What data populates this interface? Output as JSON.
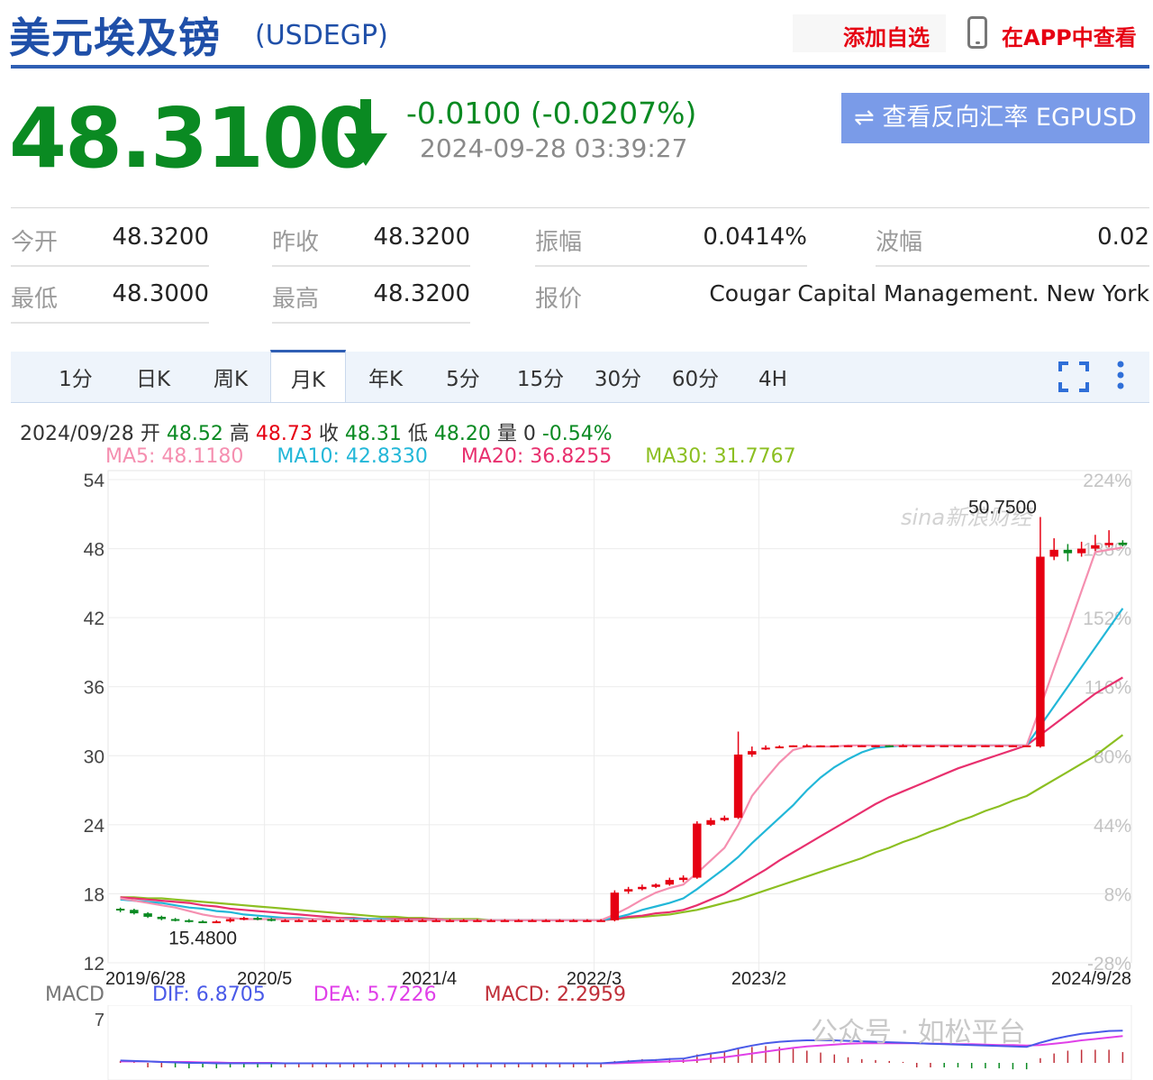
{
  "header": {
    "title": "美元埃及镑",
    "code": "(USDEGP)",
    "add_watchlist": "添加自选",
    "view_in_app": "在APP中查看"
  },
  "quote": {
    "price": "48.3100",
    "change": "-0.0100 (-0.0207%)",
    "timestamp": "2024-09-28 03:39:27",
    "reverse_button": "⇌ 查看反向汇率 EGPUSD"
  },
  "stats": {
    "open_label": "今开",
    "open": "48.3200",
    "prev_close_label": "昨收",
    "prev_close": "48.3200",
    "amplitude_label": "振幅",
    "amplitude": "0.0414%",
    "wave_label": "波幅",
    "wave": "0.02",
    "low_label": "最低",
    "low": "48.3000",
    "high_label": "最高",
    "high": "48.3200",
    "quoter_label": "报价",
    "quoter": "Cougar Capital Management. New York"
  },
  "tabs": [
    "1分",
    "日K",
    "周K",
    "月K",
    "年K",
    "5分",
    "15分",
    "30分",
    "60分",
    "4H"
  ],
  "active_tab": "月K",
  "ohlc": {
    "date": "2024/09/28",
    "open_label": "开",
    "open": "48.52",
    "high_label": "高",
    "high": "48.73",
    "close_label": "收",
    "close": "48.31",
    "low_label": "低",
    "low": "48.20",
    "vol_label": "量",
    "vol": "0",
    "pct": "-0.54%"
  },
  "ma": {
    "ma5": "MA5: 48.1180",
    "ma10": "MA10: 42.8330",
    "ma20": "MA20: 36.8255",
    "ma30": "MA30: 31.7767"
  },
  "macd": {
    "label": "MACD",
    "dif": "DIF: 6.8705",
    "dea": "DEA: 5.7226",
    "macd": "MACD: 2.2959",
    "y_tick": "7"
  },
  "watermark": {
    "brand": "sina新浪财经",
    "wechat": "公众号 · 如松平台"
  },
  "colors": {
    "up": "#e60012",
    "down": "#0a8a22",
    "ma5": "#f58fb0",
    "ma10": "#22b7d8",
    "ma20": "#e8306e",
    "ma30": "#8cbf22",
    "dif": "#4a5ae8",
    "dea": "#e040e8",
    "macd": "#c0303a"
  },
  "chart_data": {
    "type": "candlestick",
    "ylim": [
      12,
      54
    ],
    "y_ticks": [
      54,
      48,
      42,
      36,
      30,
      24,
      18,
      12
    ],
    "pct_ticks": [
      "224%",
      "188%",
      "152%",
      "116%",
      "80%",
      "44%",
      "8%",
      "-28%"
    ],
    "x_labels": [
      "2019/6/28",
      "2020/5",
      "2021/4",
      "2022/3",
      "2023/2",
      "2024/9/28"
    ],
    "annotations": {
      "max": "50.7500",
      "min": "15.4800"
    },
    "candles": [
      [
        16.7,
        16.6,
        16.8,
        16.4
      ],
      [
        16.6,
        16.3,
        16.7,
        16.2
      ],
      [
        16.3,
        16.0,
        16.4,
        15.9
      ],
      [
        16.0,
        15.8,
        16.1,
        15.7
      ],
      [
        15.8,
        15.7,
        15.9,
        15.6
      ],
      [
        15.7,
        15.6,
        15.8,
        15.5
      ],
      [
        15.6,
        15.5,
        15.7,
        15.48
      ],
      [
        15.5,
        15.6,
        15.7,
        15.48
      ],
      [
        15.6,
        15.8,
        15.9,
        15.5
      ],
      [
        15.8,
        15.9,
        16.0,
        15.7
      ],
      [
        15.9,
        15.8,
        16.0,
        15.7
      ],
      [
        15.8,
        15.7,
        15.9,
        15.6
      ],
      [
        15.7,
        15.7,
        15.8,
        15.6
      ],
      [
        15.7,
        15.7,
        15.8,
        15.6
      ],
      [
        15.7,
        15.7,
        15.8,
        15.6
      ],
      [
        15.7,
        15.7,
        15.8,
        15.6
      ],
      [
        15.7,
        15.7,
        15.8,
        15.6
      ],
      [
        15.7,
        15.7,
        15.8,
        15.6
      ],
      [
        15.7,
        15.7,
        15.8,
        15.6
      ],
      [
        15.7,
        15.7,
        15.8,
        15.6
      ],
      [
        15.7,
        15.7,
        15.8,
        15.6
      ],
      [
        15.7,
        15.7,
        15.8,
        15.6
      ],
      [
        15.7,
        15.7,
        15.8,
        15.6
      ],
      [
        15.7,
        15.7,
        15.8,
        15.6
      ],
      [
        15.7,
        15.7,
        15.8,
        15.6
      ],
      [
        15.7,
        15.7,
        15.8,
        15.6
      ],
      [
        15.7,
        15.7,
        15.8,
        15.6
      ],
      [
        15.7,
        15.7,
        15.8,
        15.6
      ],
      [
        15.7,
        15.7,
        15.8,
        15.6
      ],
      [
        15.7,
        15.7,
        15.8,
        15.6
      ],
      [
        15.7,
        15.7,
        15.8,
        15.6
      ],
      [
        15.7,
        15.7,
        15.8,
        15.6
      ],
      [
        15.7,
        15.7,
        15.8,
        15.6
      ],
      [
        15.7,
        15.7,
        15.8,
        15.6
      ],
      [
        15.7,
        15.7,
        15.8,
        15.6
      ],
      [
        15.7,
        15.7,
        15.8,
        15.6
      ],
      [
        15.7,
        18.1,
        18.3,
        15.6
      ],
      [
        18.2,
        18.4,
        18.6,
        18.0
      ],
      [
        18.4,
        18.6,
        18.8,
        18.3
      ],
      [
        18.6,
        18.8,
        18.9,
        18.5
      ],
      [
        18.8,
        19.2,
        19.4,
        18.7
      ],
      [
        19.2,
        19.4,
        19.6,
        19.0
      ],
      [
        19.4,
        24.1,
        24.3,
        19.3
      ],
      [
        24.0,
        24.4,
        24.6,
        23.9
      ],
      [
        24.4,
        24.6,
        24.8,
        24.3
      ],
      [
        24.6,
        30.1,
        32.1,
        24.5
      ],
      [
        30.1,
        30.4,
        30.8,
        29.9
      ],
      [
        30.6,
        30.7,
        30.9,
        30.5
      ],
      [
        30.8,
        30.8,
        30.9,
        30.7
      ],
      [
        30.8,
        30.9,
        30.9,
        30.8
      ],
      [
        30.9,
        30.9,
        31.0,
        30.8
      ],
      [
        30.9,
        30.9,
        30.9,
        30.8
      ],
      [
        30.9,
        30.9,
        30.9,
        30.8
      ],
      [
        30.9,
        30.9,
        30.9,
        30.8
      ],
      [
        30.9,
        30.9,
        30.9,
        30.8
      ],
      [
        30.9,
        30.9,
        30.9,
        30.8
      ],
      [
        30.9,
        30.8,
        30.9,
        30.8
      ],
      [
        30.8,
        30.9,
        31.0,
        30.8
      ],
      [
        30.9,
        30.9,
        30.9,
        30.8
      ],
      [
        30.9,
        30.9,
        30.9,
        30.8
      ],
      [
        30.9,
        30.9,
        30.9,
        30.8
      ],
      [
        30.9,
        30.9,
        30.9,
        30.8
      ],
      [
        30.9,
        30.9,
        30.9,
        30.8
      ],
      [
        30.9,
        30.9,
        30.9,
        30.8
      ],
      [
        30.9,
        30.9,
        30.9,
        30.8
      ],
      [
        30.9,
        30.9,
        30.9,
        30.8
      ],
      [
        30.9,
        30.9,
        30.9,
        30.8
      ],
      [
        30.8,
        47.3,
        50.75,
        30.7
      ],
      [
        47.3,
        47.9,
        48.9,
        47.0
      ],
      [
        47.9,
        47.6,
        48.4,
        46.9
      ],
      [
        47.6,
        48.0,
        48.6,
        47.3
      ],
      [
        48.0,
        48.3,
        49.2,
        47.8
      ],
      [
        48.3,
        48.5,
        49.6,
        48.1
      ],
      [
        48.52,
        48.31,
        48.73,
        48.2
      ]
    ],
    "ma5": [
      17.6,
      17.4,
      17.2,
      17.0,
      16.8,
      16.5,
      16.2,
      16.0,
      15.9,
      15.8,
      15.8,
      15.8,
      15.8,
      15.8,
      15.8,
      15.8,
      15.8,
      15.7,
      15.7,
      15.7,
      15.7,
      15.7,
      15.7,
      15.7,
      15.7,
      15.7,
      15.7,
      15.7,
      15.7,
      15.7,
      15.7,
      15.7,
      15.7,
      15.7,
      15.7,
      15.7,
      16.2,
      16.8,
      17.5,
      18.1,
      18.5,
      18.8,
      19.8,
      20.9,
      22.0,
      24.0,
      26.5,
      28.0,
      29.4,
      30.5,
      30.8,
      30.8,
      30.8,
      30.9,
      30.9,
      30.9,
      30.9,
      30.9,
      30.9,
      30.9,
      30.9,
      30.9,
      30.9,
      30.9,
      30.9,
      30.9,
      30.9,
      34.2,
      37.6,
      40.9,
      44.3,
      47.7,
      47.9,
      48.1
    ],
    "ma10": [
      17.5,
      17.4,
      17.3,
      17.2,
      17.0,
      16.8,
      16.7,
      16.5,
      16.4,
      16.2,
      16.1,
      16.0,
      15.9,
      15.9,
      15.8,
      15.8,
      15.8,
      15.8,
      15.8,
      15.8,
      15.7,
      15.7,
      15.7,
      15.7,
      15.7,
      15.7,
      15.7,
      15.7,
      15.7,
      15.7,
      15.7,
      15.7,
      15.7,
      15.7,
      15.7,
      15.7,
      15.9,
      16.2,
      16.6,
      16.9,
      17.2,
      17.6,
      18.4,
      19.3,
      20.2,
      21.2,
      22.4,
      23.5,
      24.6,
      25.7,
      27.0,
      28.1,
      29.0,
      29.7,
      30.3,
      30.7,
      30.8,
      30.9,
      30.9,
      30.9,
      30.9,
      30.9,
      30.9,
      30.9,
      30.9,
      30.9,
      30.9,
      32.6,
      34.3,
      36.0,
      37.7,
      39.4,
      41.1,
      42.8
    ],
    "ma20": [
      17.7,
      17.6,
      17.5,
      17.4,
      17.3,
      17.2,
      17.0,
      16.9,
      16.7,
      16.6,
      16.5,
      16.4,
      16.3,
      16.2,
      16.1,
      16.0,
      15.9,
      15.9,
      15.8,
      15.8,
      15.8,
      15.8,
      15.8,
      15.8,
      15.7,
      15.7,
      15.7,
      15.7,
      15.7,
      15.7,
      15.7,
      15.7,
      15.7,
      15.7,
      15.7,
      15.7,
      15.8,
      16.0,
      16.1,
      16.3,
      16.4,
      16.6,
      17.0,
      17.5,
      18.0,
      18.7,
      19.4,
      20.1,
      20.9,
      21.6,
      22.3,
      23.0,
      23.7,
      24.4,
      25.1,
      25.8,
      26.4,
      26.9,
      27.4,
      27.9,
      28.4,
      28.9,
      29.3,
      29.7,
      30.1,
      30.5,
      30.9,
      31.8,
      32.7,
      33.6,
      34.5,
      35.4,
      36.1,
      36.8
    ],
    "ma30": [
      17.7,
      17.7,
      17.6,
      17.6,
      17.5,
      17.4,
      17.3,
      17.2,
      17.1,
      17.0,
      16.9,
      16.8,
      16.7,
      16.6,
      16.5,
      16.4,
      16.3,
      16.2,
      16.1,
      16.0,
      16.0,
      15.9,
      15.9,
      15.8,
      15.8,
      15.8,
      15.8,
      15.7,
      15.7,
      15.7,
      15.7,
      15.7,
      15.7,
      15.7,
      15.7,
      15.7,
      15.8,
      15.9,
      16.0,
      16.1,
      16.2,
      16.4,
      16.6,
      16.9,
      17.2,
      17.5,
      17.9,
      18.3,
      18.7,
      19.1,
      19.5,
      19.9,
      20.3,
      20.7,
      21.1,
      21.6,
      22.0,
      22.5,
      22.9,
      23.4,
      23.8,
      24.3,
      24.7,
      25.2,
      25.6,
      26.1,
      26.5,
      27.2,
      27.9,
      28.6,
      29.3,
      30.0,
      30.9,
      31.8
    ],
    "macd_dif": [
      0.5,
      0.4,
      0.3,
      0.2,
      0.1,
      0.0,
      0.0,
      -0.1,
      -0.1,
      -0.1,
      -0.1,
      -0.1,
      -0.1,
      -0.1,
      -0.1,
      -0.1,
      -0.1,
      -0.1,
      -0.1,
      -0.1,
      -0.1,
      -0.1,
      -0.1,
      -0.1,
      -0.1,
      -0.1,
      -0.1,
      -0.1,
      -0.1,
      -0.1,
      -0.1,
      -0.1,
      -0.1,
      -0.1,
      -0.1,
      -0.1,
      0.1,
      0.3,
      0.5,
      0.6,
      0.8,
      0.9,
      1.5,
      2.0,
      2.4,
      3.1,
      3.7,
      4.2,
      4.5,
      4.7,
      4.8,
      4.8,
      4.8,
      4.7,
      4.6,
      4.5,
      4.4,
      4.3,
      4.2,
      4.1,
      4.0,
      3.9,
      3.8,
      3.7,
      3.6,
      3.5,
      3.4,
      4.3,
      5.1,
      5.7,
      6.2,
      6.5,
      6.8,
      6.87
    ],
    "macd_dea": [
      0.3,
      0.3,
      0.3,
      0.2,
      0.2,
      0.2,
      0.1,
      0.1,
      0.0,
      0.0,
      0.0,
      0.0,
      -0.1,
      -0.1,
      -0.1,
      -0.1,
      -0.1,
      -0.1,
      -0.1,
      -0.1,
      -0.1,
      -0.1,
      -0.1,
      -0.1,
      -0.1,
      -0.1,
      -0.1,
      -0.1,
      -0.1,
      -0.1,
      -0.1,
      -0.1,
      -0.1,
      -0.1,
      -0.1,
      -0.1,
      -0.1,
      0.0,
      0.1,
      0.2,
      0.3,
      0.4,
      0.6,
      0.9,
      1.2,
      1.6,
      2.0,
      2.4,
      2.8,
      3.2,
      3.5,
      3.7,
      3.9,
      4.1,
      4.2,
      4.2,
      4.2,
      4.2,
      4.2,
      4.1,
      4.1,
      4.0,
      4.0,
      3.9,
      3.8,
      3.8,
      3.7,
      3.8,
      4.1,
      4.4,
      4.8,
      5.1,
      5.4,
      5.72
    ]
  }
}
